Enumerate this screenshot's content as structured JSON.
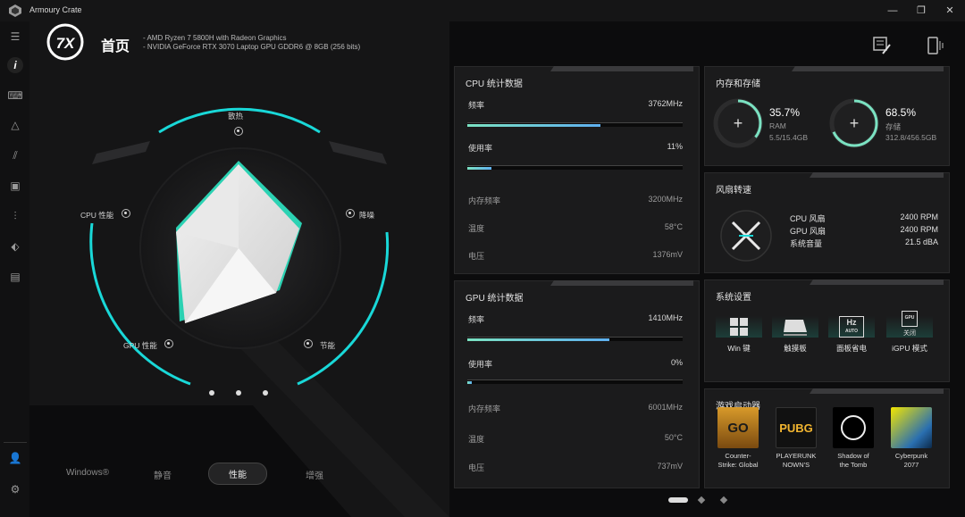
{
  "app": {
    "title": "Armoury Crate"
  },
  "window_controls": {
    "minimize": "—",
    "restore": "❐",
    "close": "✕"
  },
  "header": {
    "title": "首页",
    "specs": [
      "-   AMD Ryzen 7 5800H with Radeon Graphics",
      "-   NVIDIA GeForce RTX 3070 Laptop GPU GDDR6 @ 8GB (256 bits)"
    ]
  },
  "radar": {
    "labels": {
      "top": "散热",
      "left": "CPU 性能",
      "right": "降噪",
      "bottom_left": "GPU 性能",
      "bottom_right": "节能"
    },
    "modes": [
      "Windows®",
      "静音",
      "性能",
      "增强"
    ],
    "active_mode": "性能"
  },
  "cpu": {
    "title": "CPU 统计数据",
    "freq_label": "频率",
    "freq_value": "3762MHz",
    "freq_pct": 0.62,
    "usage_label": "使用率",
    "usage_value": "11%",
    "usage_pct": 0.11,
    "mem_freq_label": "内存频率",
    "mem_freq_value": "3200MHz",
    "temp_label": "温度",
    "temp_value": "58°C",
    "volt_label": "电压",
    "volt_value": "1376mV"
  },
  "gpu": {
    "title": "GPU 统计数据",
    "freq_label": "频率",
    "freq_value": "1410MHz",
    "freq_pct": 0.66,
    "usage_label": "使用率",
    "usage_value": "0%",
    "usage_pct": 0.0,
    "mem_freq_label": "内存频率",
    "mem_freq_value": "6001MHz",
    "temp_label": "温度",
    "temp_value": "50°C",
    "volt_label": "电压",
    "volt_value": "737mV"
  },
  "memory": {
    "title": "内存和存储",
    "ram_pct": "35.7%",
    "ram_label": "RAM",
    "ram_detail": "5.5/15.4GB",
    "ram_fraction": 0.357,
    "storage_pct": "68.5%",
    "storage_label": "存储",
    "storage_detail": "312.8/456.5GB",
    "storage_fraction": 0.685
  },
  "fan": {
    "title": "风扇转速",
    "cpu_label": "CPU 风扇",
    "cpu_value": "2400 RPM",
    "gpu_label": "GPU 风扇",
    "gpu_value": "2400 RPM",
    "noise_label": "系统音量",
    "noise_value": "21.5 dBA"
  },
  "system": {
    "title": "系统设置",
    "items": [
      {
        "label": "Win 键",
        "icon": "windows-key-icon"
      },
      {
        "label": "触摸板",
        "icon": "touchpad-icon"
      },
      {
        "label": "面板省电",
        "icon": "panel-hz-icon"
      },
      {
        "label": "iGPU 模式",
        "icon": "igpu-icon",
        "state": "关闭"
      }
    ],
    "hz_text": "Hz",
    "auto_text": "AUTO",
    "gpu_text": "GPU"
  },
  "games": {
    "title": "游戏启动器",
    "items": [
      {
        "line1": "Counter-",
        "line2": "Strike: Global",
        "art": "GO"
      },
      {
        "line1": "PLAYERUNK",
        "line2": "NOWN'S",
        "art": "PUBG"
      },
      {
        "line1": "Shadow of",
        "line2": "the Tomb",
        "art": ""
      },
      {
        "line1": "Cyberpunk",
        "line2": "2077",
        "art": ""
      }
    ]
  },
  "colors": {
    "accent": "#19d8d8",
    "bar_start": "#7be2c2",
    "bar_end": "#5fb0f0",
    "ring": "#7be2c2"
  }
}
